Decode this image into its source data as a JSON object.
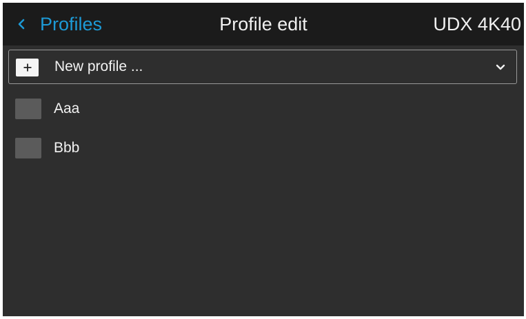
{
  "header": {
    "back_label": "Profiles",
    "title": "Profile edit",
    "device_name": "UDX 4K40",
    "back_icon": "chevron-left-icon"
  },
  "new_profile": {
    "label": "New profile ...",
    "add_icon": "plus-icon",
    "dropdown_icon": "chevron-down-icon"
  },
  "profiles": [
    {
      "label": "Aaa"
    },
    {
      "label": "Bbb"
    }
  ],
  "colors": {
    "accent": "#1d9ad6",
    "header_bg": "#1b1b1b",
    "screen_bg": "#2e2e2e",
    "swatch": "#5b5b5b"
  }
}
